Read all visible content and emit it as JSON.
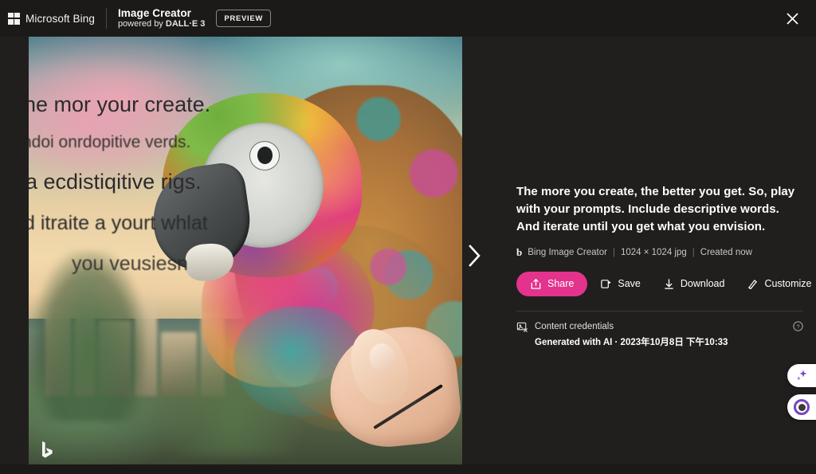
{
  "header": {
    "brand": "Microsoft Bing",
    "logo_icon": "microsoft-grid-icon",
    "product_title": "Image Creator",
    "product_subtitle_prefix": "powered by ",
    "product_subtitle_model": "DALL·E 3",
    "preview_badge": "PREVIEW",
    "close_icon": "close-icon"
  },
  "image": {
    "watermark_icon": "bing-b-watermark-icon",
    "next_icon": "chevron-right-icon",
    "overlay_text_lines": [
      "he mor your create.",
      "ndoi onrdopitive verds.",
      "a ecdistiqitive rigs.",
      "d  itraite a yourt whlat",
      "you veusiesn"
    ],
    "subject": "colorful macaw parrot with ornate feathers and a hand holding a pencil"
  },
  "details": {
    "prompt": "The more you create, the better you get. So, play with your prompts. Include descriptive words. And iterate until you get what you envision.",
    "source_icon": "bing-b-icon",
    "source": "Bing Image Creator",
    "dimensions": "1024 × 1024 jpg",
    "created": "Created now",
    "separator": "|"
  },
  "actions": [
    {
      "label": "Share",
      "icon": "share-icon",
      "primary": true
    },
    {
      "label": "Save",
      "icon": "save-collection-icon",
      "primary": false
    },
    {
      "label": "Download",
      "icon": "download-icon",
      "primary": false
    },
    {
      "label": "Customize",
      "icon": "customize-wand-icon",
      "primary": false
    }
  ],
  "credentials": {
    "icon": "content-credentials-icon",
    "title": "Content credentials",
    "detail": "Generated with AI · 2023年10月8日 下午10:33",
    "help_icon": "help-circle-icon"
  },
  "floating": [
    {
      "name": "copilot-sparkle-widget",
      "icon": "sparkle-icon"
    },
    {
      "name": "assistant-avatar-widget",
      "icon": "avatar-circle-icon"
    }
  ],
  "colors": {
    "accent_pink": "#e3338c",
    "background": "#211f1e",
    "header_bg": "#1b1a19",
    "copilot_purple": "#7a42c8"
  }
}
